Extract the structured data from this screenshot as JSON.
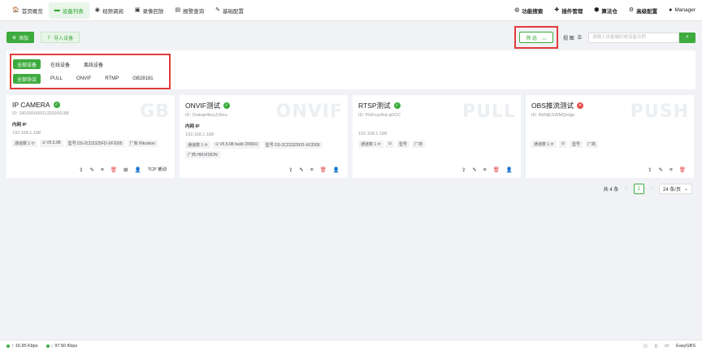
{
  "nav": {
    "items": [
      {
        "icon": "home-icon",
        "glyph": "🏠",
        "label": "首页概览"
      },
      {
        "icon": "device-icon",
        "glyph": "▬",
        "label": "设备列表"
      },
      {
        "icon": "video-icon",
        "glyph": "◉",
        "label": "视频调阅"
      },
      {
        "icon": "playback-icon",
        "glyph": "▣",
        "label": "录像回放"
      },
      {
        "icon": "alarm-icon",
        "glyph": "▤",
        "label": "报警查询"
      },
      {
        "icon": "config-icon",
        "glyph": "✎",
        "label": "基础配置"
      }
    ],
    "right": [
      {
        "icon": "search-icon",
        "glyph": "◍",
        "label": "功能搜索"
      },
      {
        "icon": "plugin-icon",
        "glyph": "✚",
        "label": "插件管理"
      },
      {
        "icon": "algorithm-icon",
        "glyph": "⬢",
        "label": "算法仓"
      },
      {
        "icon": "gear-icon",
        "glyph": "⚙",
        "label": "高级配置"
      },
      {
        "icon": "user-icon",
        "glyph": "●",
        "label": "Manager"
      }
    ]
  },
  "toolbar": {
    "add_label": "添加",
    "import_label": "导入设备",
    "filter_label": "筛 选",
    "view_label": "视 图",
    "search_placeholder": "请输入设备编码或设备名称"
  },
  "filters": {
    "status": [
      "全部设备",
      "在线设备",
      "离线设备"
    ],
    "protocol": [
      "全部协议",
      "PULL",
      "ONVIF",
      "RTMP",
      "GB28181"
    ]
  },
  "cards": [
    {
      "title": "IP CAMERA",
      "status": "online",
      "bg": "GB",
      "id": "ID: 34020000001320000188",
      "net": "内网 IP",
      "ip": "192.168.1.188",
      "tags": [
        "通道数 1 ⟳",
        "⊙ V5.5.98",
        "型号 DS-2CD2325FD-XF2005",
        "厂商 Hikvision"
      ],
      "actions": [
        "⇪",
        "✎",
        "≡",
        "🗑",
        "⊞",
        "👤"
      ],
      "extra": "TCP 被动"
    },
    {
      "title": "ONVIF测试",
      "status": "online",
      "bg": "ONVIF",
      "id": "ID: Owbqe4kcy1Weu",
      "net": "内网 IP",
      "ip": "192.168.1.188",
      "tags": [
        "通道数 1 ⟳",
        "⊙ V5.5.98 build 200601",
        "型号 DS-2CD2325FD-XF2005",
        "厂商 HIKVISION"
      ],
      "actions": [
        "⇪",
        "✎",
        "≡",
        "🗑",
        "👤"
      ],
      "extra": ""
    },
    {
      "title": "RTSP测试",
      "status": "online",
      "bg": "PULL",
      "id": "ID: PEKvyy4uLqOCC",
      "net": "",
      "ip": "192.168.1.188",
      "tags": [
        "通道数 1 ⟳",
        "⊙",
        "型号",
        "厂商"
      ],
      "actions": [
        "⇪",
        "✎",
        "≡",
        "🗑",
        "👤"
      ],
      "extra": ""
    },
    {
      "title": "OBS推流测试",
      "status": "offline",
      "bg": "PUSH",
      "id": "ID: RkMjESWMQnIgp",
      "net": "",
      "ip": "",
      "tags": [
        "通道数 1 ⟳",
        "⊙",
        "型号",
        "厂商"
      ],
      "actions": [
        "⇪",
        "✎",
        "≡",
        "🗑"
      ],
      "extra": ""
    }
  ],
  "pager": {
    "total": "共 4 条",
    "page": "1",
    "size": "24 条/页"
  },
  "bottom": {
    "up": "16.95 Kbps",
    "down": "97.50 Kbps",
    "brand": "EasyGBS"
  }
}
